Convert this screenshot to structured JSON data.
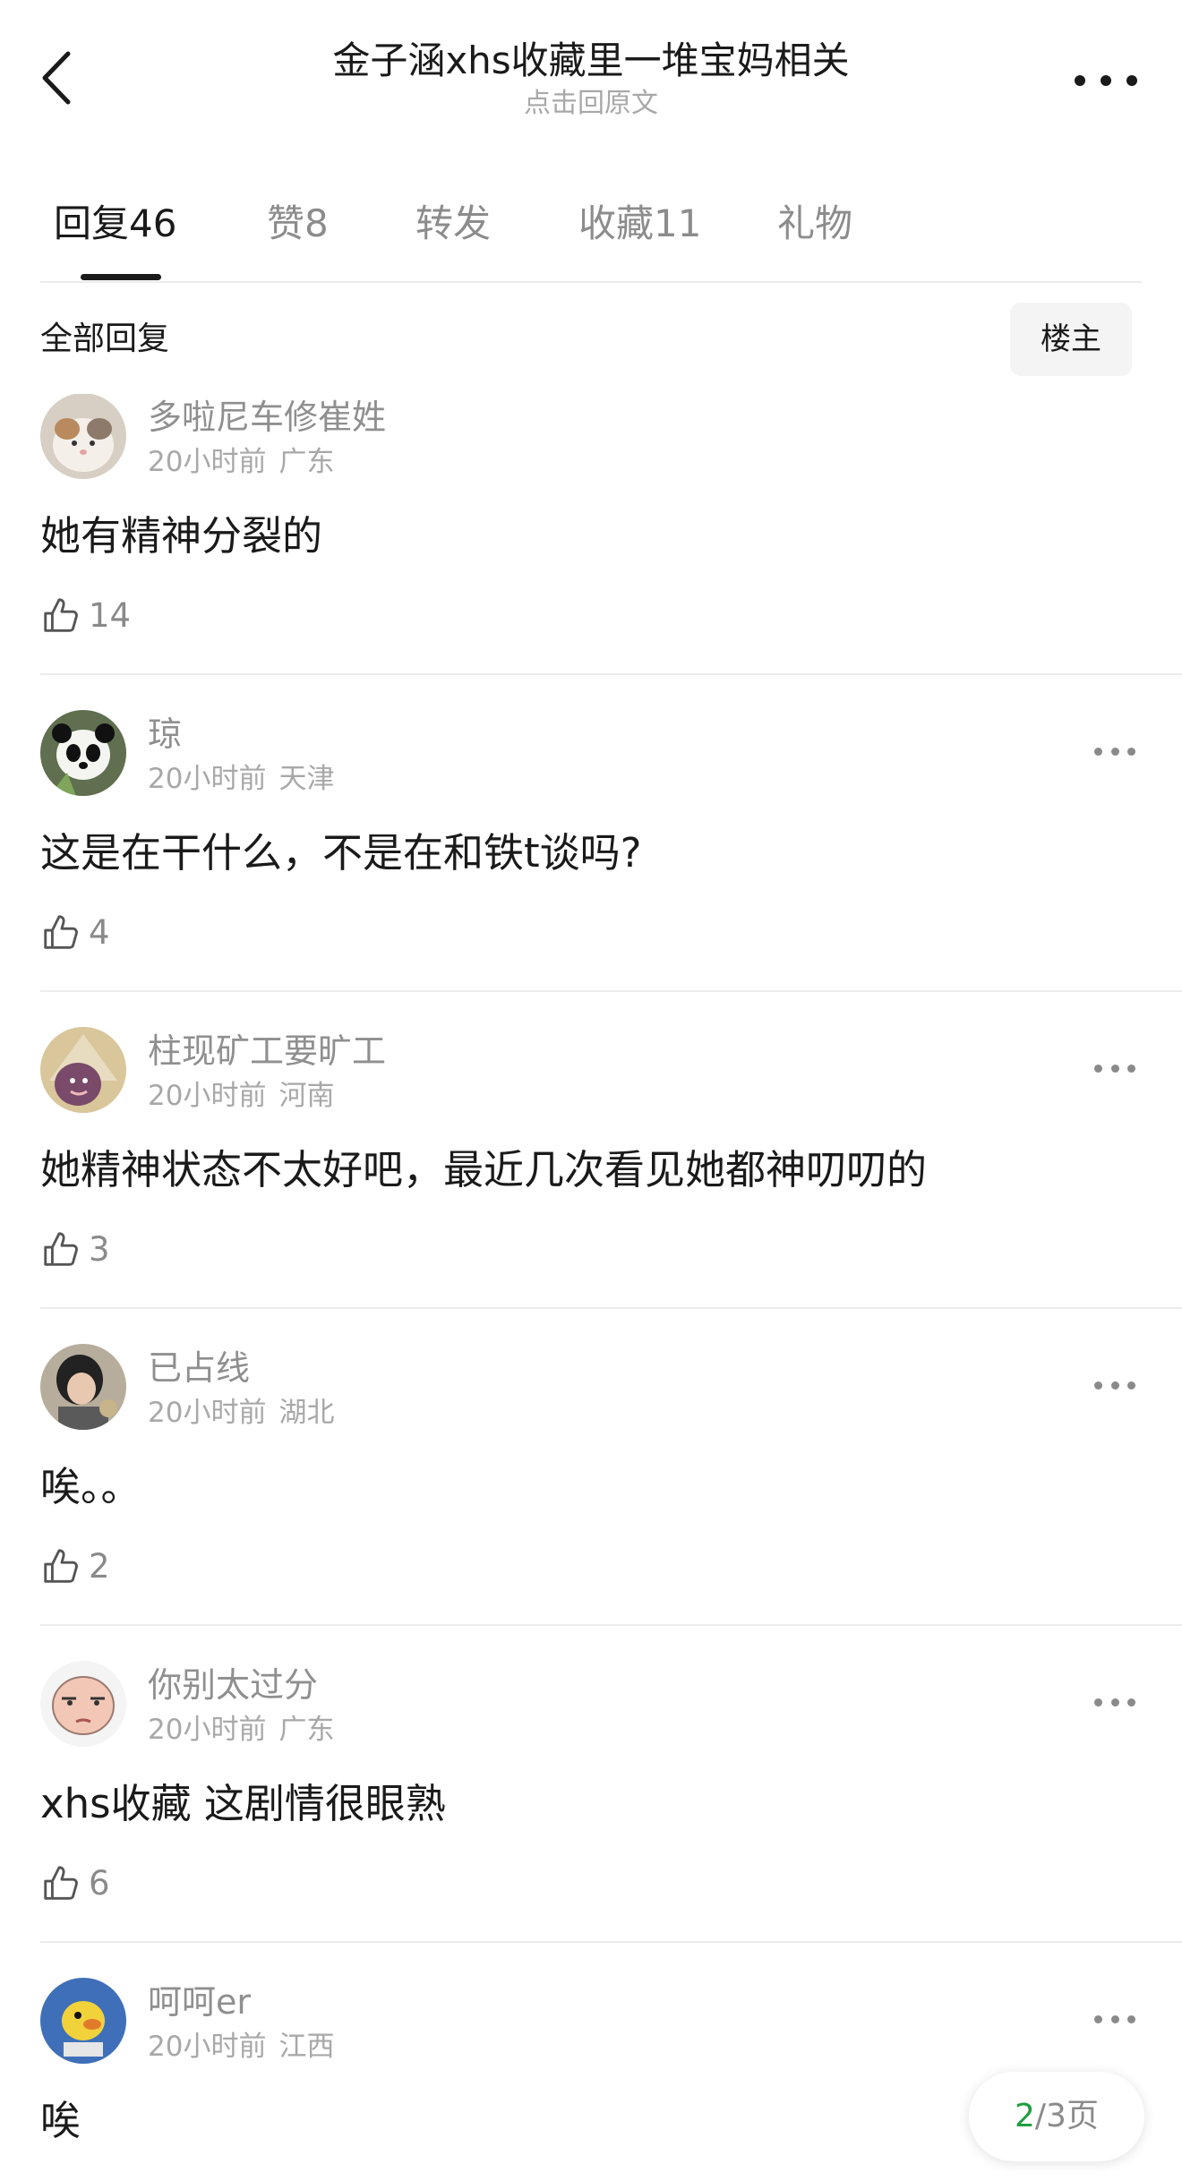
{
  "header": {
    "title": "金子涵xhs收藏里一堆宝妈相关",
    "subtitle": "点击回原文"
  },
  "tabs": [
    {
      "label": "回复",
      "count": "46"
    },
    {
      "label": "赞",
      "count": "8"
    },
    {
      "label": "转发",
      "count": ""
    },
    {
      "label": "收藏",
      "count": "11"
    },
    {
      "label": "礼物",
      "count": ""
    }
  ],
  "filter": {
    "title": "全部回复",
    "op_button": "楼主"
  },
  "comments": [
    {
      "username": "多啦尼车修崔姓",
      "time": "20小时前",
      "region": "广东",
      "text": "她有精神分裂的",
      "likes": "14"
    },
    {
      "username": "琼",
      "time": "20小时前",
      "region": "天津",
      "text": "这是在干什么，不是在和铁t谈吗?",
      "likes": "4"
    },
    {
      "username": "柱现矿工要旷工",
      "time": "20小时前",
      "region": "河南",
      "text": "她精神状态不太好吧，最近几次看见她都神叨叨的",
      "likes": "3"
    },
    {
      "username": "已占线",
      "time": "20小时前",
      "region": "湖北",
      "text": "唉。。",
      "likes": "2"
    },
    {
      "username": "你别太过分",
      "time": "20小时前",
      "region": "广东",
      "text": "xhs收藏 这剧情很眼熟",
      "likes": "6"
    },
    {
      "username": "呵呵er",
      "time": "20小时前",
      "region": "江西",
      "text": "唉",
      "likes": ""
    }
  ],
  "pagination": {
    "current": "2",
    "total": "/3页"
  }
}
